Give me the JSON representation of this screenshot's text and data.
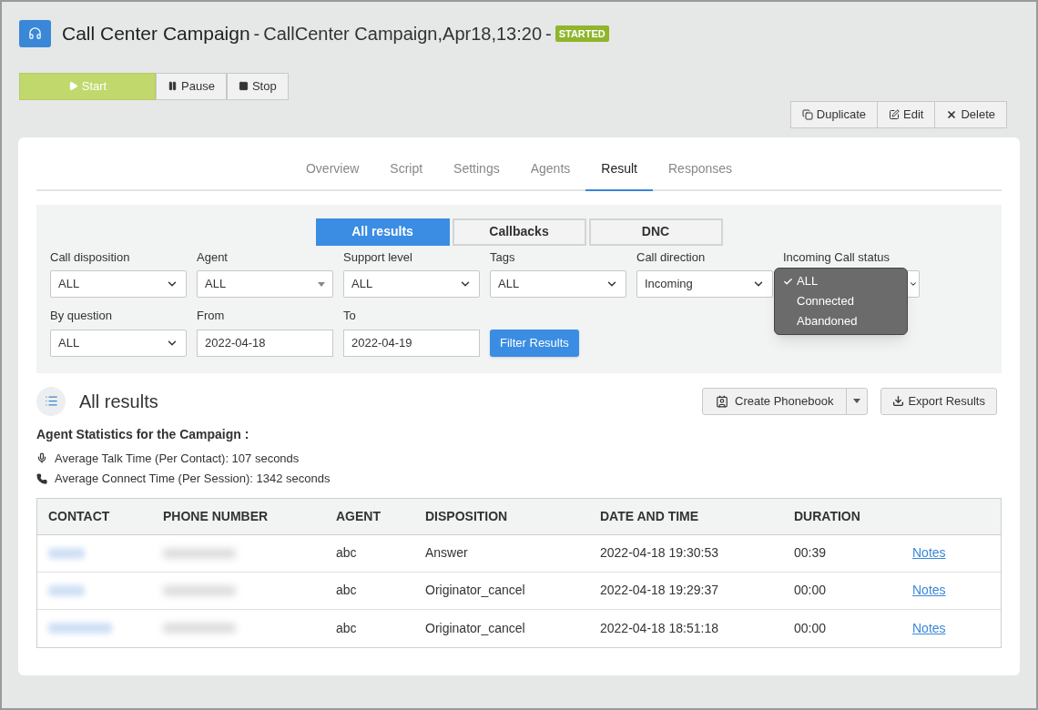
{
  "header": {
    "title": "Call Center Campaign",
    "subtitle": "CallCenter Campaign,Apr18,13:20",
    "separator": "-",
    "status": "STARTED"
  },
  "controls": [
    {
      "kind": "start",
      "label": "Start",
      "selected": true
    },
    {
      "kind": "pause",
      "label": "Pause",
      "selected": false
    },
    {
      "kind": "stop",
      "label": "Stop",
      "selected": false
    }
  ],
  "actions": [
    {
      "kind": "duplicate",
      "label": "Duplicate"
    },
    {
      "kind": "edit",
      "label": "Edit"
    },
    {
      "kind": "delete",
      "label": "Delete"
    }
  ],
  "tabs": [
    {
      "label": "Overview",
      "selected": false
    },
    {
      "label": "Script",
      "selected": false
    },
    {
      "label": "Settings",
      "selected": false
    },
    {
      "label": "Agents",
      "selected": false
    },
    {
      "label": "Result",
      "selected": true
    },
    {
      "label": "Responses",
      "selected": false
    }
  ],
  "result_tabs": [
    {
      "label": "All results",
      "selected": true
    },
    {
      "label": "Callbacks",
      "selected": false
    },
    {
      "label": "DNC",
      "selected": false
    }
  ],
  "filters": [
    {
      "kind": "select",
      "label": "Call disposition",
      "value": "ALL"
    },
    {
      "kind": "combo",
      "label": "Agent",
      "value": "ALL"
    },
    {
      "kind": "select",
      "label": "Support level",
      "value": "ALL"
    },
    {
      "kind": "select",
      "label": "Tags",
      "value": "ALL"
    },
    {
      "kind": "select",
      "label": "Call direction",
      "value": "Incoming"
    },
    {
      "kind": "open",
      "label": "Incoming Call status",
      "options": [
        {
          "label": "ALL",
          "selected": true
        },
        {
          "label": "Connected",
          "selected": false
        },
        {
          "label": "Abandoned",
          "selected": false
        }
      ]
    },
    {
      "kind": "select",
      "label": "By question",
      "value": "ALL"
    },
    {
      "kind": "input",
      "label": "From",
      "value": "2022-04-18"
    },
    {
      "kind": "input",
      "label": "To",
      "value": "2022-04-19"
    }
  ],
  "filter_button": "Filter Results",
  "results": {
    "title": "All results",
    "create_button": "Create Phonebook",
    "export_button": "Export Results",
    "stats_title": "Agent Statistics for the Campaign :",
    "stats": [
      {
        "kind": "mic",
        "text": "Average Talk Time (Per Contact): 107 seconds"
      },
      {
        "kind": "phone",
        "text": "Average Connect Time (Per Session): 1342 seconds"
      }
    ]
  },
  "table": {
    "columns": [
      "CONTACT",
      "PHONE NUMBER",
      "AGENT",
      "DISPOSITION",
      "DATE AND TIME",
      "DURATION"
    ],
    "rows": [
      {
        "agent": "abc",
        "disposition": "Answer",
        "date_time": "2022-04-18 19:30:53",
        "duration": "00:39",
        "link": "Notes"
      },
      {
        "agent": "abc",
        "disposition": "Originator_cancel",
        "date_time": "2022-04-18 19:29:37",
        "duration": "00:00",
        "link": "Notes"
      },
      {
        "agent": "abc",
        "disposition": "Originator_cancel",
        "date_time": "2022-04-18 18:51:18",
        "duration": "00:00",
        "link": "Notes"
      }
    ]
  }
}
